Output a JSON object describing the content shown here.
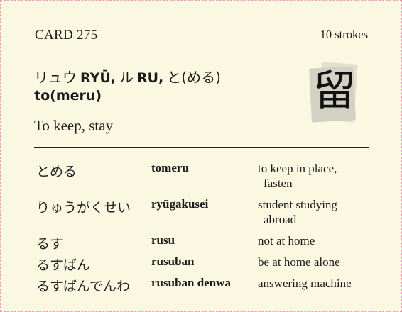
{
  "card": {
    "id_label": "CARD 275",
    "strokes": "10 strokes",
    "reading_kana_on1": "リュウ",
    "reading_roma_on1": "RYŪ,",
    "reading_kana_on2": "ル",
    "reading_roma_on2": "RU,",
    "reading_kana_kun": "と(める)",
    "reading_roma_kun": "to(meru)",
    "meaning": "To keep, stay",
    "kanji": "留"
  },
  "vocab": [
    {
      "kana": "とめる",
      "romaji": "tomeru",
      "meaning_1": "to keep in place,",
      "meaning_2": "fasten"
    },
    {
      "kana": "りゅうがくせい",
      "romaji": "ryūgakusei",
      "meaning_1": "student studying",
      "meaning_2": "abroad"
    },
    {
      "kana": "るす",
      "romaji": "rusu",
      "meaning_1": "not at home",
      "meaning_2": ""
    },
    {
      "kana": "るすばん",
      "romaji": "rusuban",
      "meaning_1": "be at home alone",
      "meaning_2": ""
    },
    {
      "kana": "るすばんでんわ",
      "romaji": "rusuban denwa",
      "meaning_1": "answering machine",
      "meaning_2": ""
    }
  ]
}
